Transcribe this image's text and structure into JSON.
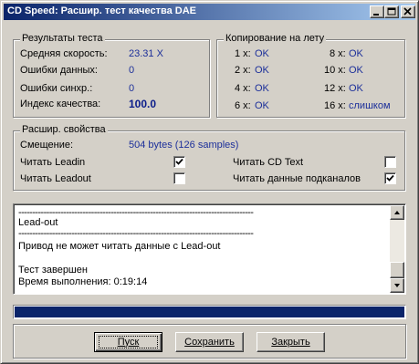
{
  "window": {
    "title": "CD Speed: Расшир. тест качества DAE"
  },
  "icons": {
    "minimize": "minimize-icon",
    "maximize": "maximize-icon",
    "close": "close-icon",
    "checkmark": "checkmark-icon",
    "scroll_up": "arrow-up-icon",
    "scroll_down": "arrow-down-icon"
  },
  "results": {
    "title": "Результаты теста",
    "rows": [
      {
        "label": "Средняя скорость:",
        "value": "23.31 X"
      },
      {
        "label": "Ошибки данных:",
        "value": "0"
      },
      {
        "label": "Ошибки синхр.:",
        "value": "0"
      },
      {
        "label": "Индекс качества:",
        "value": "100.0"
      }
    ]
  },
  "copy": {
    "title": "Копирование на лету",
    "left": [
      {
        "label": "1 x:",
        "value": "OK"
      },
      {
        "label": "2 x:",
        "value": "OK"
      },
      {
        "label": "4 x:",
        "value": "OK"
      },
      {
        "label": "6 x:",
        "value": "OK"
      }
    ],
    "right": [
      {
        "label": "8 x:",
        "value": "OK"
      },
      {
        "label": "10 x:",
        "value": "OK"
      },
      {
        "label": "12 x:",
        "value": "OK"
      },
      {
        "label": "16 x:",
        "value": "слишком"
      }
    ]
  },
  "props": {
    "title": "Расшир. свойства",
    "offset_label": "Смещение:",
    "offset_value": "504 bytes (126 samples)",
    "checkboxes": [
      {
        "label": "Читать Leadin",
        "checked": true
      },
      {
        "label": "Читать Leadout",
        "checked": false
      },
      {
        "label": "Читать CD Text",
        "checked": false
      },
      {
        "label": "Читать данные подканалов",
        "checked": true
      }
    ]
  },
  "log": {
    "lines": [
      "------------------------------------------------------------------------------------",
      "Lead-out",
      "------------------------------------------------------------------------------------",
      "Привод не может читать данные с Lead-out",
      "",
      "Тест завершен",
      "Время выполнения:  0:19:14"
    ]
  },
  "progress": {
    "value": 1.0
  },
  "buttons": {
    "start": "Пуск",
    "save": "Сохранить",
    "close": "Закрыть"
  },
  "colors": {
    "title_gradient_start": "#0a246a",
    "title_gradient_end": "#a6caf0",
    "value_text": "#1c2f9a",
    "progress_fill": "#0a246a",
    "face": "#d4d0c8"
  }
}
